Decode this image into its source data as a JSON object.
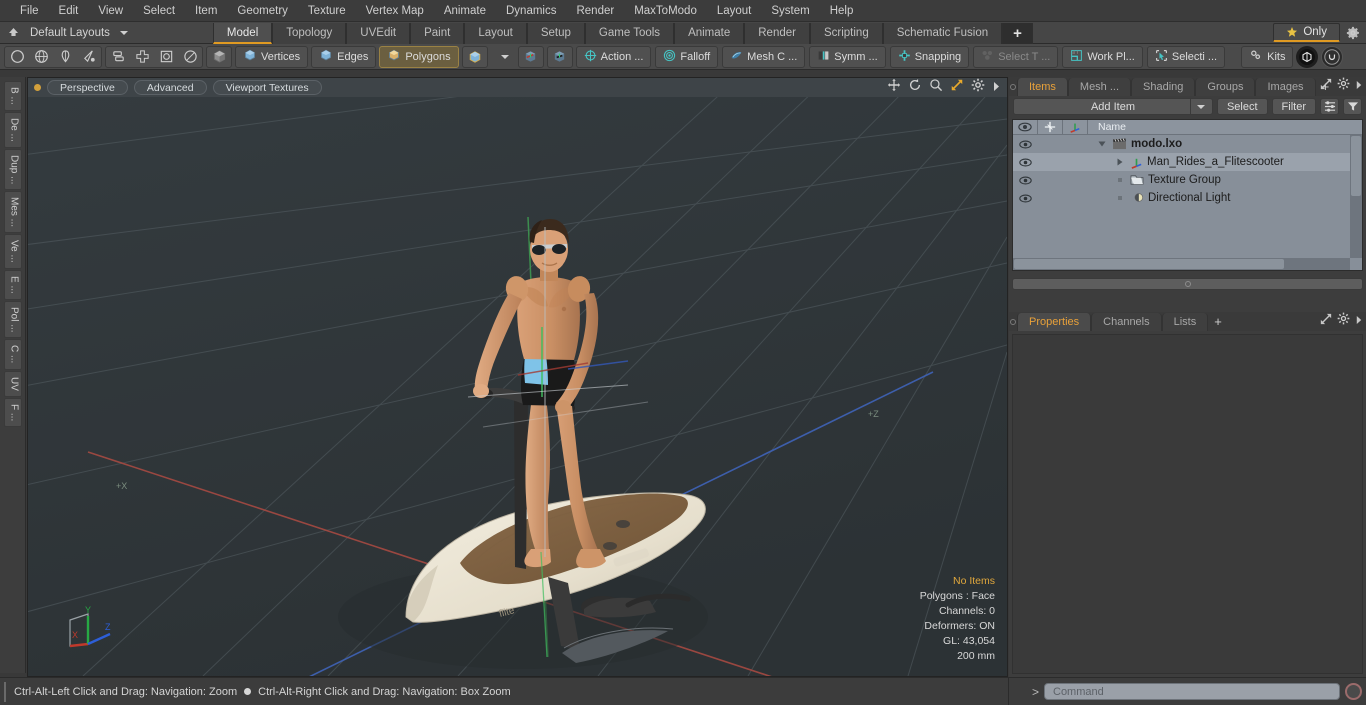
{
  "menu": {
    "items": [
      "File",
      "Edit",
      "View",
      "Select",
      "Item",
      "Geometry",
      "Texture",
      "Vertex Map",
      "Animate",
      "Dynamics",
      "Render",
      "MaxToModo",
      "Layout",
      "System",
      "Help"
    ]
  },
  "layout_bar": {
    "home_icon": "home-up-icon",
    "layout_name": "Default Layouts",
    "tabs": [
      {
        "label": "Model",
        "active": true
      },
      {
        "label": "Topology",
        "active": false
      },
      {
        "label": "UVEdit",
        "active": false
      },
      {
        "label": "Paint",
        "active": false
      },
      {
        "label": "Layout",
        "active": false
      },
      {
        "label": "Setup",
        "active": false
      },
      {
        "label": "Game Tools",
        "active": false
      },
      {
        "label": "Animate",
        "active": false
      },
      {
        "label": "Render",
        "active": false
      },
      {
        "label": "Scripting",
        "active": false
      },
      {
        "label": "Schematic Fusion",
        "active": false
      }
    ],
    "add_tab_label": "+",
    "only_label": "Only",
    "only_icon": "star-icon",
    "gear_icon": "gear-icon"
  },
  "toolbar": {
    "shape_icons": [
      "circle-icon",
      "globe-icon",
      "pen-icon",
      "cone-icon"
    ],
    "mesh_op_icons": [
      "stack-icon",
      "cross-icon",
      "square-dot-icon",
      "ellipse-icon"
    ],
    "element_icon": "grey-cube-icon",
    "selection_modes": [
      {
        "label": "Vertices",
        "icon": "vertices-cube-icon",
        "selected": false
      },
      {
        "label": "Edges",
        "icon": "edges-cube-icon",
        "selected": false
      },
      {
        "label": "Polygons",
        "icon": "polygons-cube-icon",
        "selected": true
      }
    ],
    "mode_dropdown_icon": "blue-cube-icon",
    "axis_icons": [
      "axis-cube-red-icon",
      "axis-cube-black-icon"
    ],
    "tools": [
      {
        "label": "Action  ...",
        "icon": "action-center-icon",
        "dim": false
      },
      {
        "label": "Falloff",
        "icon": "falloff-icon",
        "dim": false
      },
      {
        "label": "Mesh C ...",
        "icon": "mesh-constraint-icon",
        "dim": false
      },
      {
        "label": "Symm ...",
        "icon": "symmetry-icon",
        "dim": false
      },
      {
        "label": "Snapping",
        "icon": "snapping-icon",
        "dim": false
      },
      {
        "label": "Select T ...",
        "icon": "select-through-icon",
        "dim": true
      },
      {
        "label": "Work Pl...",
        "icon": "work-plane-icon",
        "dim": false
      },
      {
        "label": "Selecti ...",
        "icon": "selection-icon",
        "dim": false
      }
    ],
    "kits_label": "Kits",
    "kits_icon": "gears-icon",
    "right_icons": [
      "modo-ball-icon",
      "unreal-engine-icon"
    ]
  },
  "left_rail": {
    "tabs": [
      "B ...",
      "De ...",
      "Dup ...",
      "Mes ...",
      "Ve ...",
      "E ...",
      "Pol ...",
      "C ...",
      "UV",
      "F ..."
    ]
  },
  "viewport": {
    "header_dot_color": "#d2a03c",
    "pills": [
      "Perspective",
      "Advanced",
      "Viewport Textures"
    ],
    "nav_icons": [
      "pan-icon",
      "rotate-icon",
      "zoom-magnifier-icon",
      "fit-arrows-icon",
      "gear-icon",
      "chevron-right-icon"
    ],
    "axis_gizmo": {
      "x": "X",
      "y": "Y",
      "z": "Z",
      "x_color": "#c0392b",
      "y_color": "#27a844",
      "z_color": "#2d5fd8"
    },
    "scene_description": "Man_Rides_a_Flitescooter 3D model on grid",
    "stats": {
      "no_items": "No Items",
      "polygons": "Polygons : Face",
      "channels": "Channels: 0",
      "deformers": "Deformers: ON",
      "gl": "GL: 43,054",
      "scale": "200 mm"
    }
  },
  "right_panel": {
    "tabs": [
      {
        "label": "Items",
        "active": true
      },
      {
        "label": "Mesh ...",
        "active": false
      },
      {
        "label": "Shading",
        "active": false
      },
      {
        "label": "Groups",
        "active": false
      },
      {
        "label": "Images",
        "active": false
      }
    ],
    "add_tab": "+",
    "header_icons": [
      "expand-arrows-icon",
      "gear-icon",
      "chevron-right-icon"
    ],
    "add_item_label": "Add Item",
    "add_item_caret_icon": "chevron-down-icon",
    "select_label": "Select",
    "filter_label": "Filter",
    "list_icon": "list-options-icon",
    "funnel_icon": "funnel-icon",
    "tree": {
      "columns": {
        "eye_icon": "eye-icon",
        "lock_icon": "crosshair-icon",
        "axis_icon": "axis-icon",
        "name_header": "Name"
      },
      "rows": [
        {
          "name": "modo.lxo",
          "icon": "clapperboard-icon",
          "depth": 0,
          "bold": true,
          "selected": false,
          "expander": "down"
        },
        {
          "name": "Man_Rides_a_Flitescooter",
          "icon": "axis-item-icon",
          "depth": 1,
          "bold": false,
          "selected": true,
          "expander": "right"
        },
        {
          "name": "Texture Group",
          "icon": "folder-icon",
          "depth": 1,
          "bold": false,
          "selected": false,
          "expander": "none"
        },
        {
          "name": "Directional Light",
          "icon": "light-icon",
          "depth": 1,
          "bold": false,
          "selected": false,
          "expander": "none"
        }
      ]
    },
    "properties": {
      "tabs": [
        {
          "label": "Properties",
          "active": true
        },
        {
          "label": "Channels",
          "active": false
        },
        {
          "label": "Lists",
          "active": false
        }
      ],
      "add_tab": "+",
      "header_icons": [
        "expand-arrows-icon",
        "gear-icon",
        "chevron-right-icon"
      ]
    }
  },
  "status_bar": {
    "hint_left": "Ctrl-Alt-Left Click and Drag: Navigation: Zoom",
    "hint_right": "Ctrl-Alt-Right Click and Drag: Navigation: Box Zoom",
    "command_caret": ">",
    "command_placeholder": "Command",
    "command_value": "",
    "record_icon": "record-circle-icon"
  }
}
